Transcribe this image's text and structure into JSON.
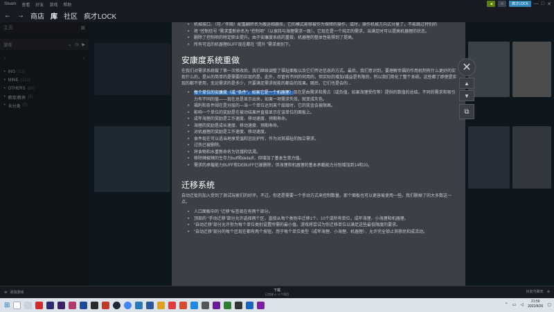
{
  "menubar": {
    "items": [
      "Steam",
      "查看",
      "好友",
      "游戏",
      "帮助"
    ],
    "user": "疯才LOCK"
  },
  "nav": {
    "store": "商店",
    "library": "库",
    "community": "社区",
    "username": "疯才LOCK"
  },
  "sidebar": {
    "home": "主页",
    "filter_label": "游戏",
    "categories": [
      {
        "label": "ING",
        "count": "(13)"
      },
      {
        "label": "MINE",
        "count": "(121)"
      },
      {
        "label": "OTHERS",
        "count": "(80)"
      },
      {
        "label": "教育/教养",
        "count": "(6)"
      },
      {
        "label": "未分类",
        "count": "(5)"
      }
    ]
  },
  "doc": {
    "intro_bullets": [
      "机械接口、（符／伴随）配重翻转名为搬运相器技，它的模式能够被作为保障的操作，或时，操作机械方向式分量了，不能跳过特别的",
      "将 “控制信号 ”需求重新命名为 “控制项”（以保持与海狸需求一致）。它现在是一个纯正的需求，当满足时可以提高机器狸的状态。",
      "删除了控制项的特定职业提升。由于安康度系统的重做，机器狸的整体性能得到了提高。",
      "所有可适的机器狸BUFF现在都在 “提升 ”需求类别下。"
    ],
    "section1_title": "安康度系统重做",
    "section1_para": "在我们对需求系统做了第一次修改后，我们继续调整了福祉面板以及它们传达信息的方式。最后，我们意识到，要理解幸福的作用机制有什么更好的实现什么的，是从的简单的是需要的实现的是。此外，尽管有不同的何用的，但实际的增加/减益是有限的，所以我们简化了整个系统。这些都了即使是实现的都不使用，无论需求的是多少，只要满足需求就能的都会的效果。随后，它们也是会的...",
    "section1_hl_prefix": "每个单位的安康度（或 “条件”，如果它是一个机器狸）",
    "section1_first_rest": "现在是由需求和需点（或负值，如果海狸受伤等）提供的数值的总结。不同的需求和吸引力有不同的值——现在总是显示出来，如果一项需求失效，就变成灰色。",
    "section1_bullets": [
      "福利和条件阈在是分层的—当一个单位达到某个层级时，它的奖金会被限高。",
      "影响一个单位的奖励是在被动结果并直接显示在该单位的面板上。",
      "成年海狸的奖励是工作速度、移动速度、预期寿命。",
      "海狸的奖励是成长速度、移动速度、预期寿命。",
      "对机器狸的奖励是工作速度、移动速度。",
      "食件现在可以适当地享受温和宜庇护所，作为对其福祉的独立需求。",
      "过热已被删除。",
      "将食物和水重新命名为饥饿和饥渴。",
      "移除辣椒辣的生存力buff和debuff，但增加了基本生育力值。",
      "需求的承载能力BUFF和DEBUFF已被删除，但海狸和机器狸的基本承载能力分别增加到14和20。"
    ],
    "section2_title": "迁移系统",
    "section2_para": "自动迁徙的加入受到了测试玩家们的好评。不过，你还是需要一个手动方式来控制数量。那个面板也可以更容易使用一些。我们删掉了的大多数这一点。",
    "section2_bullets": [
      "人口面板中的 “迁移”标签现在有两个部分。",
      "顶部的 “手动迁移”部分允许选择两个区，直接从每个类别中迁移1个、10个或所有单位，成年海狸、小海狸和机器狸。",
      "“自动迁移”部分允许你为每个单位类别设置所需的最小值。游戏将尝试为你迁移单位以满足这些最低限度的要求。",
      "“自动迁移”部分的每个区现在都有两个按钮，用于每个单位类型（成年海狸、小海狸、机器狸），允许完全锁止其移民和成活动。"
    ]
  },
  "bottom": {
    "add_game": "添加游戏",
    "downloads": "下载",
    "downloads_sub": "已完成 4 / 4 个项目",
    "friends": "好友与聊天"
  },
  "clock": {
    "time": "21:59",
    "date": "2022/8/26"
  }
}
